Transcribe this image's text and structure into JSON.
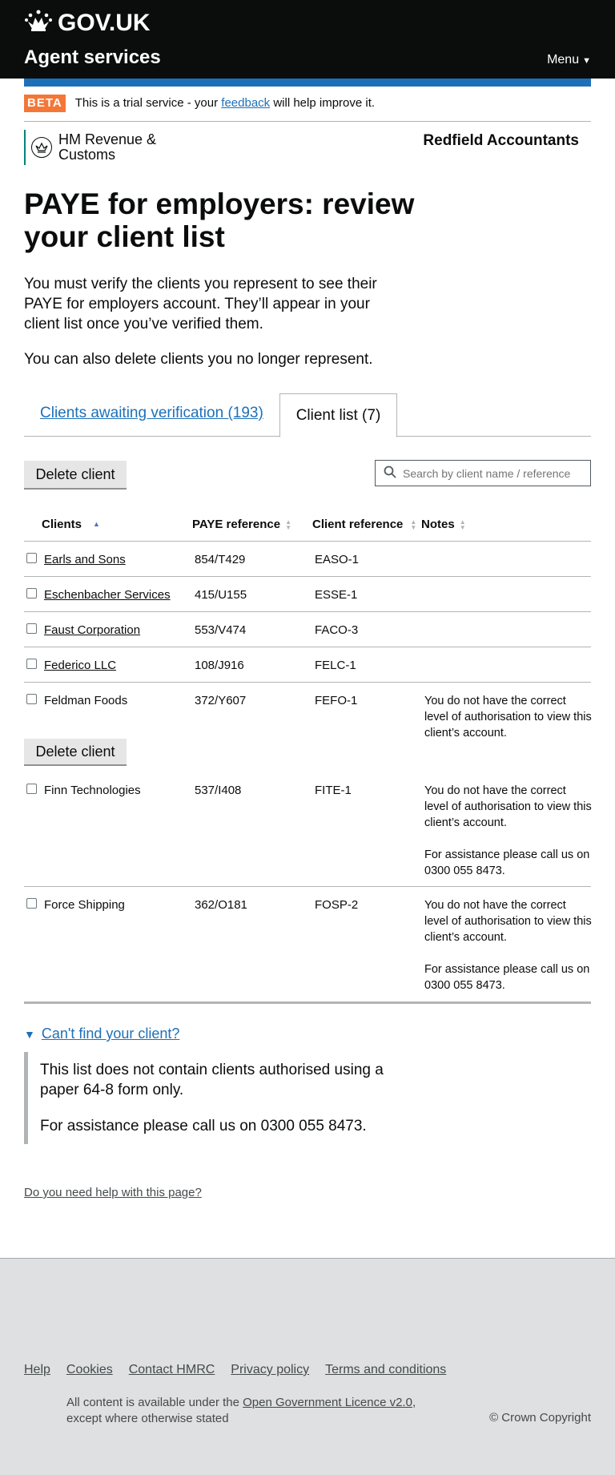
{
  "header": {
    "logo_text": "GOV.UK",
    "service_name": "Agent services",
    "menu_label": "Menu"
  },
  "phase_banner": {
    "tag": "BETA",
    "text_before": "This is a trial service - your ",
    "link": "feedback",
    "text_after": " will help improve it."
  },
  "org": {
    "name_line1": "HM Revenue &",
    "name_line2": "Customs",
    "agency_name": "Redfield Accountants"
  },
  "page": {
    "title": "PAYE for employers: review your client list",
    "intro": "You must verify the clients you represent to see their PAYE for employers account. They’ll appear in your client list once you’ve verified them.",
    "delete_note": "You can also delete clients you no longer represent."
  },
  "tabs": {
    "awaiting": "Clients awaiting verification (193)",
    "client_list": "Client list (7)"
  },
  "toolbar": {
    "delete_label": "Delete client",
    "search_placeholder": "Search by client name / reference"
  },
  "table": {
    "headers": {
      "clients": "Clients",
      "paye": "PAYE reference",
      "client_ref": "Client reference",
      "notes": "Notes"
    },
    "rows": [
      {
        "name": "Earls and Sons",
        "paye": "854/T429",
        "ref": "EASO-1",
        "note1": "",
        "note2": ""
      },
      {
        "name": "Eschenbacher Services",
        "paye": "415/U155",
        "ref": "ESSE-1",
        "note1": "",
        "note2": ""
      },
      {
        "name": "Faust Corporation",
        "paye": "553/V474",
        "ref": "FACO-3",
        "note1": "",
        "note2": ""
      },
      {
        "name": "Federico LLC",
        "paye": "108/J916",
        "ref": "FELC-1",
        "note1": "",
        "note2": ""
      },
      {
        "name": "Feldman Foods",
        "paye": "372/Y607",
        "ref": "FEFO-1",
        "note1": "You do not have the correct level of authorisation to view this client’s account.",
        "note2": ""
      },
      {
        "name": "Finn Technologies",
        "paye": "537/I408",
        "ref": "FITE-1",
        "note1": "You do not have the correct level of authorisation to view this client’s account.",
        "note2": "For assistance please call us on 0300 055 8473."
      },
      {
        "name": "Force Shipping",
        "paye": "362/O181",
        "ref": "FOSP-2",
        "note1": "You do not have the correct level of authorisation to view this client’s account.",
        "note2": "For assistance please call us on 0300 055 8473."
      }
    ],
    "bottom_delete_label": "Delete client"
  },
  "details": {
    "summary": "Can't find your client?",
    "para1": "This list does not contain clients authorised using a paper 64-8 form only.",
    "para2": "For assistance please call us on 0300 055 8473."
  },
  "help_link": "Do you need help with this page?",
  "footer": {
    "links": [
      "Help",
      "Cookies",
      "Contact HMRC",
      "Privacy policy",
      "Terms and conditions"
    ],
    "licence_before": "All content is available under the ",
    "licence_link": "Open Government Licence v2.0",
    "licence_after": ", except where otherwise stated",
    "copyright": "© Crown Copyright"
  },
  "colors": {
    "header_bg": "#0b0c0c",
    "brand_blue": "#1d70b8",
    "beta_orange": "#f47738",
    "hmrc_teal": "#00847a",
    "footer_bg": "#dee0e2"
  }
}
